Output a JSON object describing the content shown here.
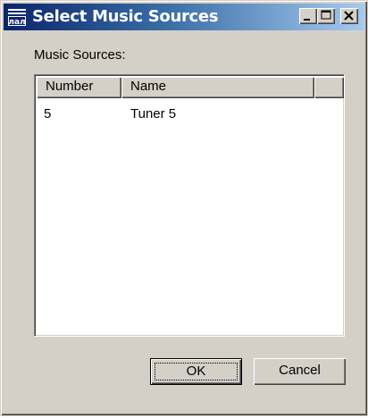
{
  "window": {
    "title": "Select Music Sources",
    "icon": "app-icon"
  },
  "title_buttons": {
    "minimize": "minimize-icon",
    "maximize": "maximize-icon",
    "close": "close-icon"
  },
  "sources_label": "Music Sources:",
  "list": {
    "columns": [
      "Number",
      "Name"
    ],
    "rows": [
      {
        "number": "5",
        "name": "Tuner 5"
      }
    ]
  },
  "buttons": {
    "ok": "OK",
    "cancel": "Cancel"
  },
  "colors": {
    "face": "#d4d0c8",
    "titlebar_start": "#0a246a",
    "titlebar_end": "#a6caf0",
    "list_background": "#ffffff"
  }
}
